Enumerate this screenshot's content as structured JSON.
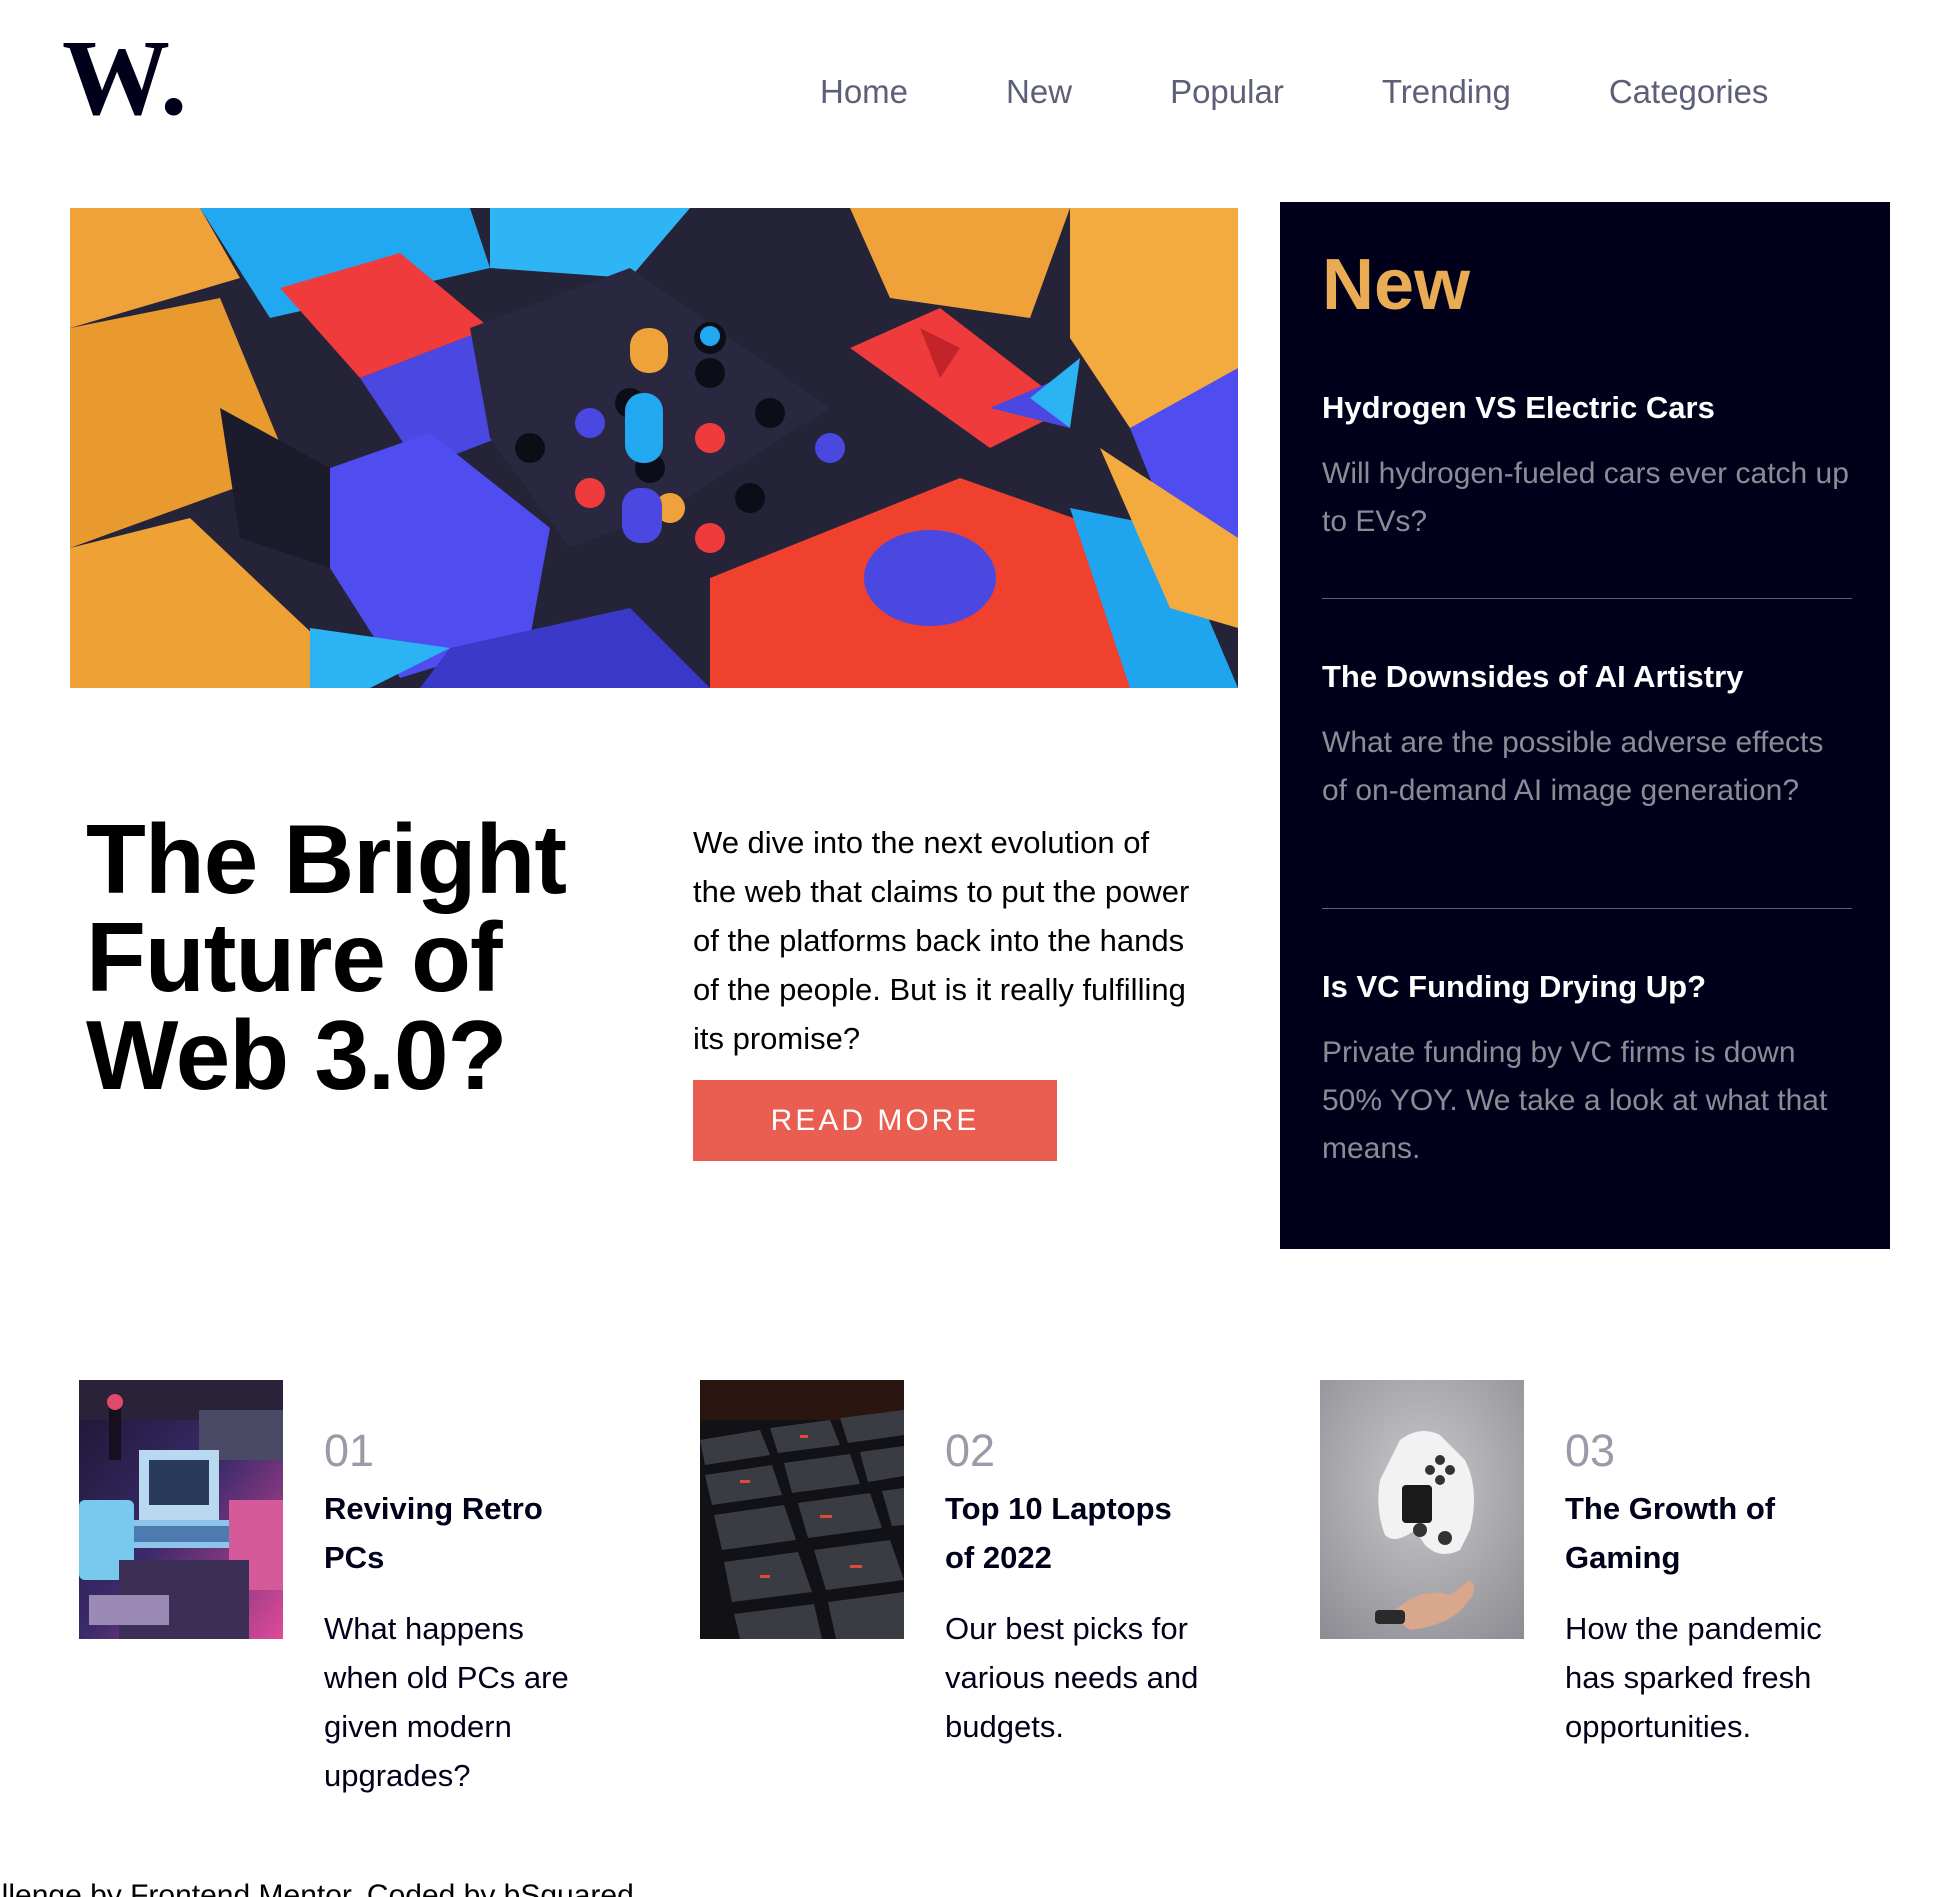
{
  "header": {
    "logo_text": "W.",
    "nav": [
      "Home",
      "New",
      "Popular",
      "Trending",
      "Categories"
    ]
  },
  "hero": {
    "title_lines": [
      "The Bright",
      "Future of",
      "Web 3.0?"
    ],
    "description": "We dive into the next evolution of the web that claims to put the power of the platforms back into the hands of the people. But is it really fulfilling its promise?",
    "button_label": "READ MORE"
  },
  "new_panel": {
    "title": "New",
    "items": [
      {
        "title": "Hydrogen VS Electric Cars",
        "desc": "Will hydrogen-fueled cars ever catch up to EVs?"
      },
      {
        "title": "The Downsides of AI Artistry",
        "desc": "What are the possible adverse effects of on-demand AI image generation?"
      },
      {
        "title": "Is VC Funding Drying Up?",
        "desc": "Private funding by VC firms is down 50% YOY. We take a look at what that means."
      }
    ]
  },
  "articles": [
    {
      "num": "01",
      "title": "Reviving Retro PCs",
      "desc": "What happens when old PCs are given modern upgrades?"
    },
    {
      "num": "02",
      "title": "Top 10 Laptops of 2022",
      "desc": "Our best picks for various needs and budgets."
    },
    {
      "num": "03",
      "title": "The Growth of Gaming",
      "desc": "How the pandemic has sparked fresh opportunities."
    }
  ],
  "footer": {
    "text": "allenge by Frontend Mentor. Coded by bSquared."
  },
  "colors": {
    "accent_red": "#ea5e51",
    "accent_orange": "#e9ab53",
    "dark_navy": "#00001a",
    "grayish_blue": "#5d5f79"
  }
}
